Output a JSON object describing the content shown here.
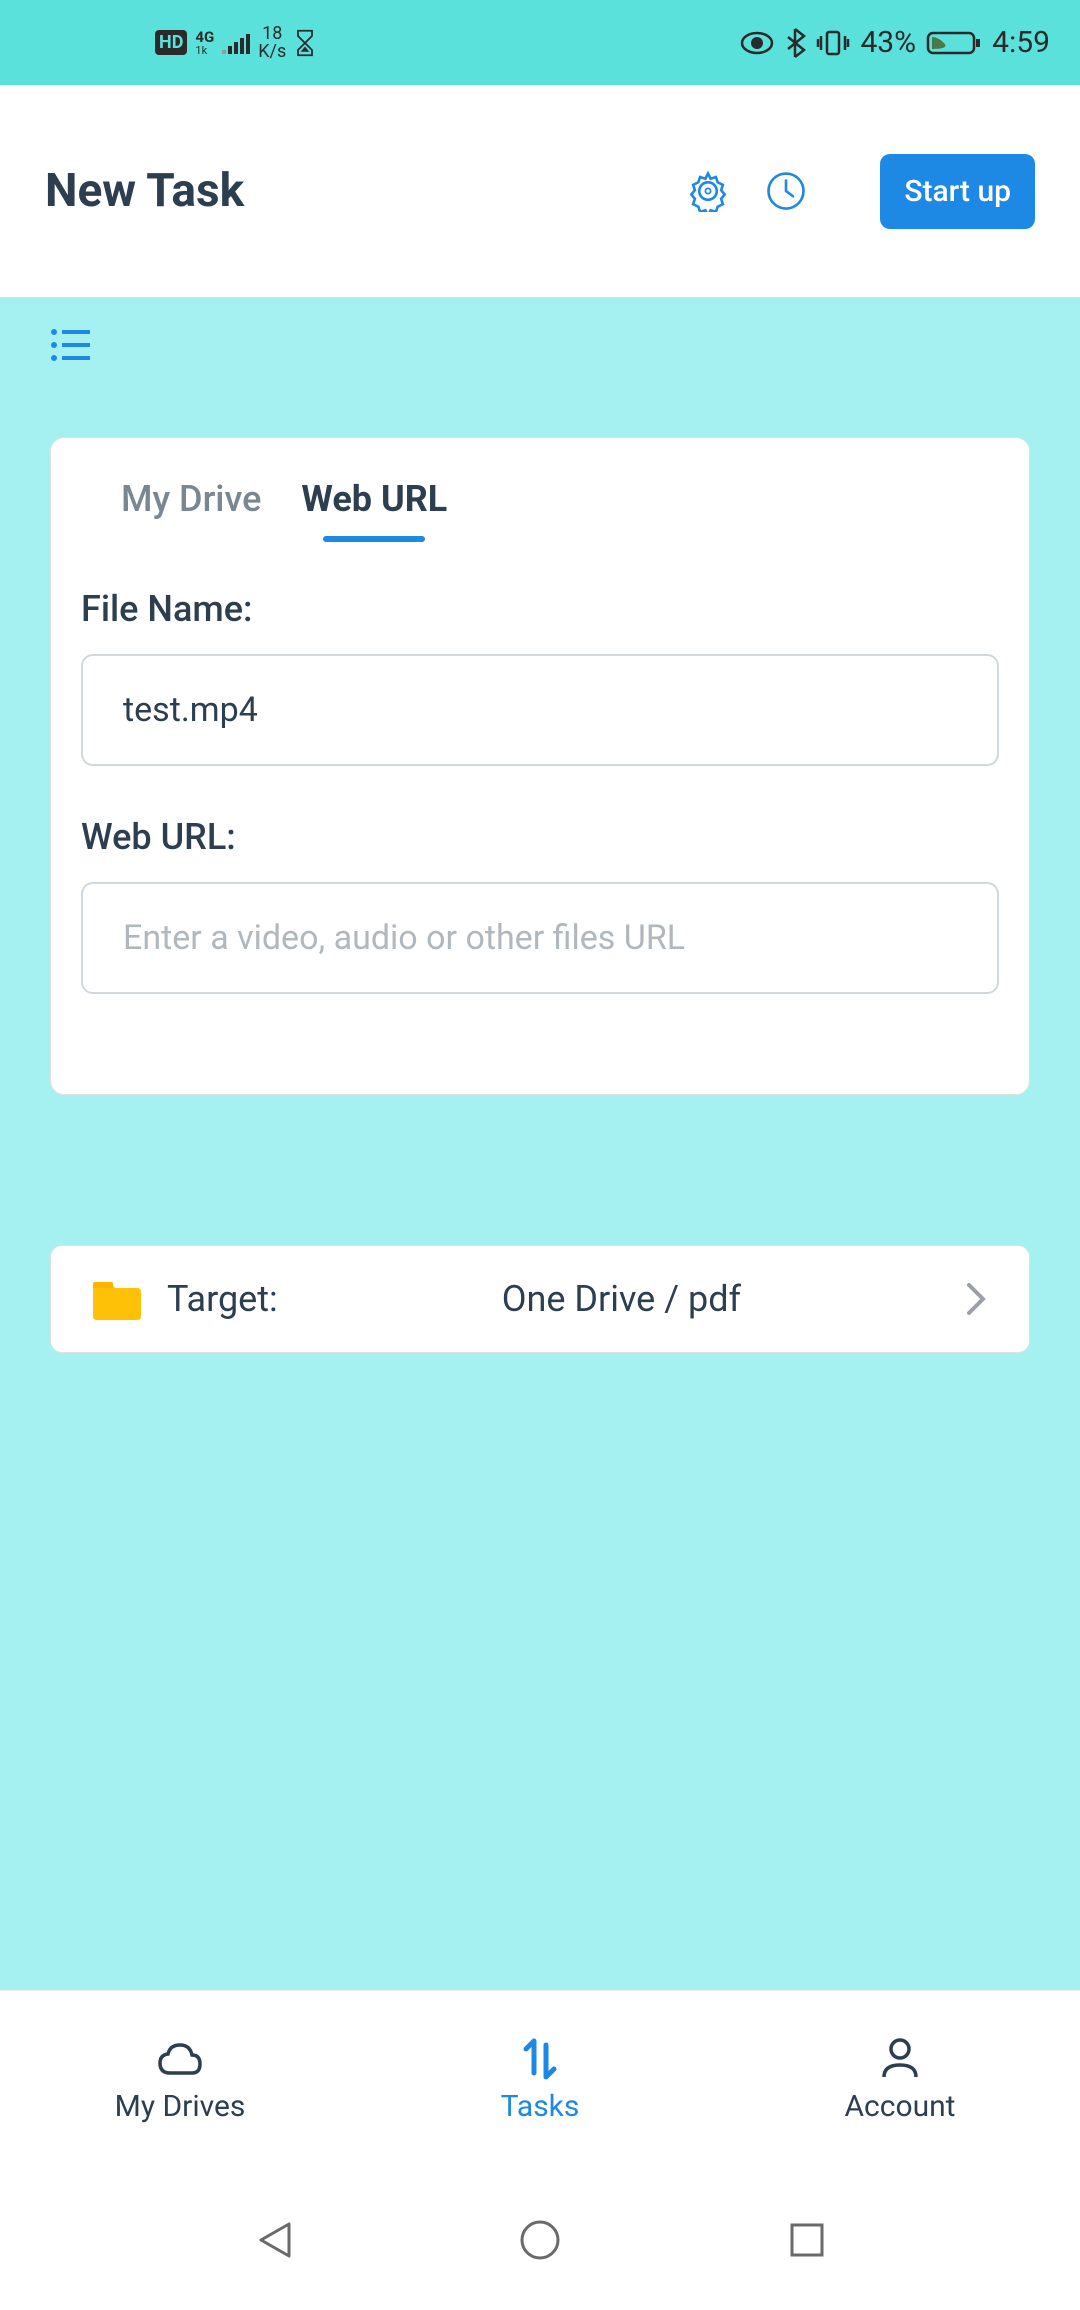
{
  "status": {
    "hd": "HD",
    "network": "4G",
    "speed_num": "18",
    "speed_unit": "K/s",
    "battery": "43%",
    "time": "4:59"
  },
  "header": {
    "title": "New Task",
    "start_btn": "Start up"
  },
  "tabs": {
    "my_drive": "My Drive",
    "web_url": "Web URL"
  },
  "form": {
    "file_name_label": "File Name:",
    "file_name_value": "test.mp4",
    "web_url_label": "Web URL:",
    "web_url_placeholder": "Enter a video, audio or other files URL"
  },
  "target": {
    "label": "Target:",
    "value": "One Drive / pdf"
  },
  "nav": {
    "drives": "My Drives",
    "tasks": "Tasks",
    "account": "Account"
  }
}
